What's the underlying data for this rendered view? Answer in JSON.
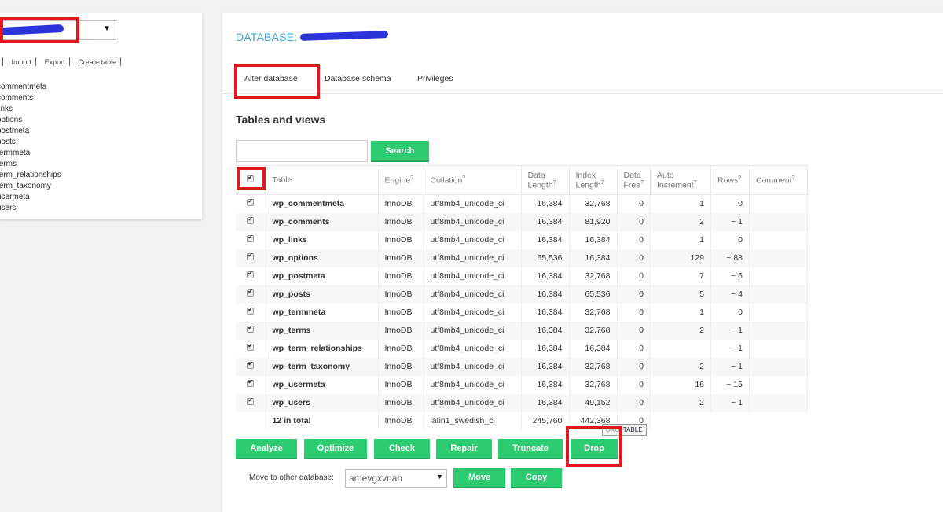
{
  "sidebar": {
    "actions": [
      "hand",
      "Import",
      "Export",
      "Create table"
    ],
    "tables": [
      "commentmeta",
      "comments",
      "links",
      "options",
      "postmeta",
      "posts",
      "termmeta",
      "terms",
      "term_relationships",
      "term_taxonomy",
      "usermeta",
      "users"
    ]
  },
  "main": {
    "title": "DATABASE:",
    "tabs": [
      "Alter database",
      "Database schema",
      "Privileges"
    ],
    "heading": "Tables and views",
    "search_button": "Search",
    "table": {
      "headers": {
        "table": "Table",
        "engine": "Engine",
        "collation": "Collation",
        "data_length_1": "Data",
        "data_length_2": "Length",
        "index_length_1": "Index",
        "index_length_2": "Length",
        "data_free_1": "Data",
        "data_free_2": "Free",
        "auto_increment_1": "Auto",
        "auto_increment_2": "Increment",
        "rows": "Rows",
        "comment": "Comment",
        "help_mark": "?"
      },
      "rows": [
        {
          "name": "wp_commentmeta",
          "engine": "InnoDB",
          "collation": "utf8mb4_unicode_ci",
          "data_length": "16,384",
          "index_length": "32,768",
          "data_free": "0",
          "auto_increment": "1",
          "rows": "0"
        },
        {
          "name": "wp_comments",
          "engine": "InnoDB",
          "collation": "utf8mb4_unicode_ci",
          "data_length": "16,384",
          "index_length": "81,920",
          "data_free": "0",
          "auto_increment": "2",
          "rows": "~ 1"
        },
        {
          "name": "wp_links",
          "engine": "InnoDB",
          "collation": "utf8mb4_unicode_ci",
          "data_length": "16,384",
          "index_length": "16,384",
          "data_free": "0",
          "auto_increment": "1",
          "rows": "0"
        },
        {
          "name": "wp_options",
          "engine": "InnoDB",
          "collation": "utf8mb4_unicode_ci",
          "data_length": "65,536",
          "index_length": "16,384",
          "data_free": "0",
          "auto_increment": "129",
          "rows": "~ 88"
        },
        {
          "name": "wp_postmeta",
          "engine": "InnoDB",
          "collation": "utf8mb4_unicode_ci",
          "data_length": "16,384",
          "index_length": "32,768",
          "data_free": "0",
          "auto_increment": "7",
          "rows": "~ 6"
        },
        {
          "name": "wp_posts",
          "engine": "InnoDB",
          "collation": "utf8mb4_unicode_ci",
          "data_length": "16,384",
          "index_length": "65,536",
          "data_free": "0",
          "auto_increment": "5",
          "rows": "~ 4"
        },
        {
          "name": "wp_termmeta",
          "engine": "InnoDB",
          "collation": "utf8mb4_unicode_ci",
          "data_length": "16,384",
          "index_length": "32,768",
          "data_free": "0",
          "auto_increment": "1",
          "rows": "0"
        },
        {
          "name": "wp_terms",
          "engine": "InnoDB",
          "collation": "utf8mb4_unicode_ci",
          "data_length": "16,384",
          "index_length": "32,768",
          "data_free": "0",
          "auto_increment": "2",
          "rows": "~ 1"
        },
        {
          "name": "wp_term_relationships",
          "engine": "InnoDB",
          "collation": "utf8mb4_unicode_ci",
          "data_length": "16,384",
          "index_length": "16,384",
          "data_free": "0",
          "auto_increment": "",
          "rows": "~ 1"
        },
        {
          "name": "wp_term_taxonomy",
          "engine": "InnoDB",
          "collation": "utf8mb4_unicode_ci",
          "data_length": "16,384",
          "index_length": "32,768",
          "data_free": "0",
          "auto_increment": "2",
          "rows": "~ 1"
        },
        {
          "name": "wp_usermeta",
          "engine": "InnoDB",
          "collation": "utf8mb4_unicode_ci",
          "data_length": "16,384",
          "index_length": "32,768",
          "data_free": "0",
          "auto_increment": "16",
          "rows": "~ 15"
        },
        {
          "name": "wp_users",
          "engine": "InnoDB",
          "collation": "utf8mb4_unicode_ci",
          "data_length": "16,384",
          "index_length": "49,152",
          "data_free": "0",
          "auto_increment": "2",
          "rows": "~ 1"
        }
      ],
      "total": {
        "name": "12 in total",
        "engine": "InnoDB",
        "collation": "latin1_swedish_ci",
        "data_length": "245,760",
        "index_length": "442,368",
        "data_free": "0"
      }
    },
    "tooltip": {
      "cut": "DRO",
      "text": "TABLE"
    },
    "actions": [
      "Analyze",
      "Optimize",
      "Check",
      "Repair",
      "Truncate",
      "Drop"
    ],
    "move": {
      "label": "Move to other database:",
      "selected": "amevgxvnah",
      "move_button": "Move",
      "copy_button": "Copy"
    }
  }
}
